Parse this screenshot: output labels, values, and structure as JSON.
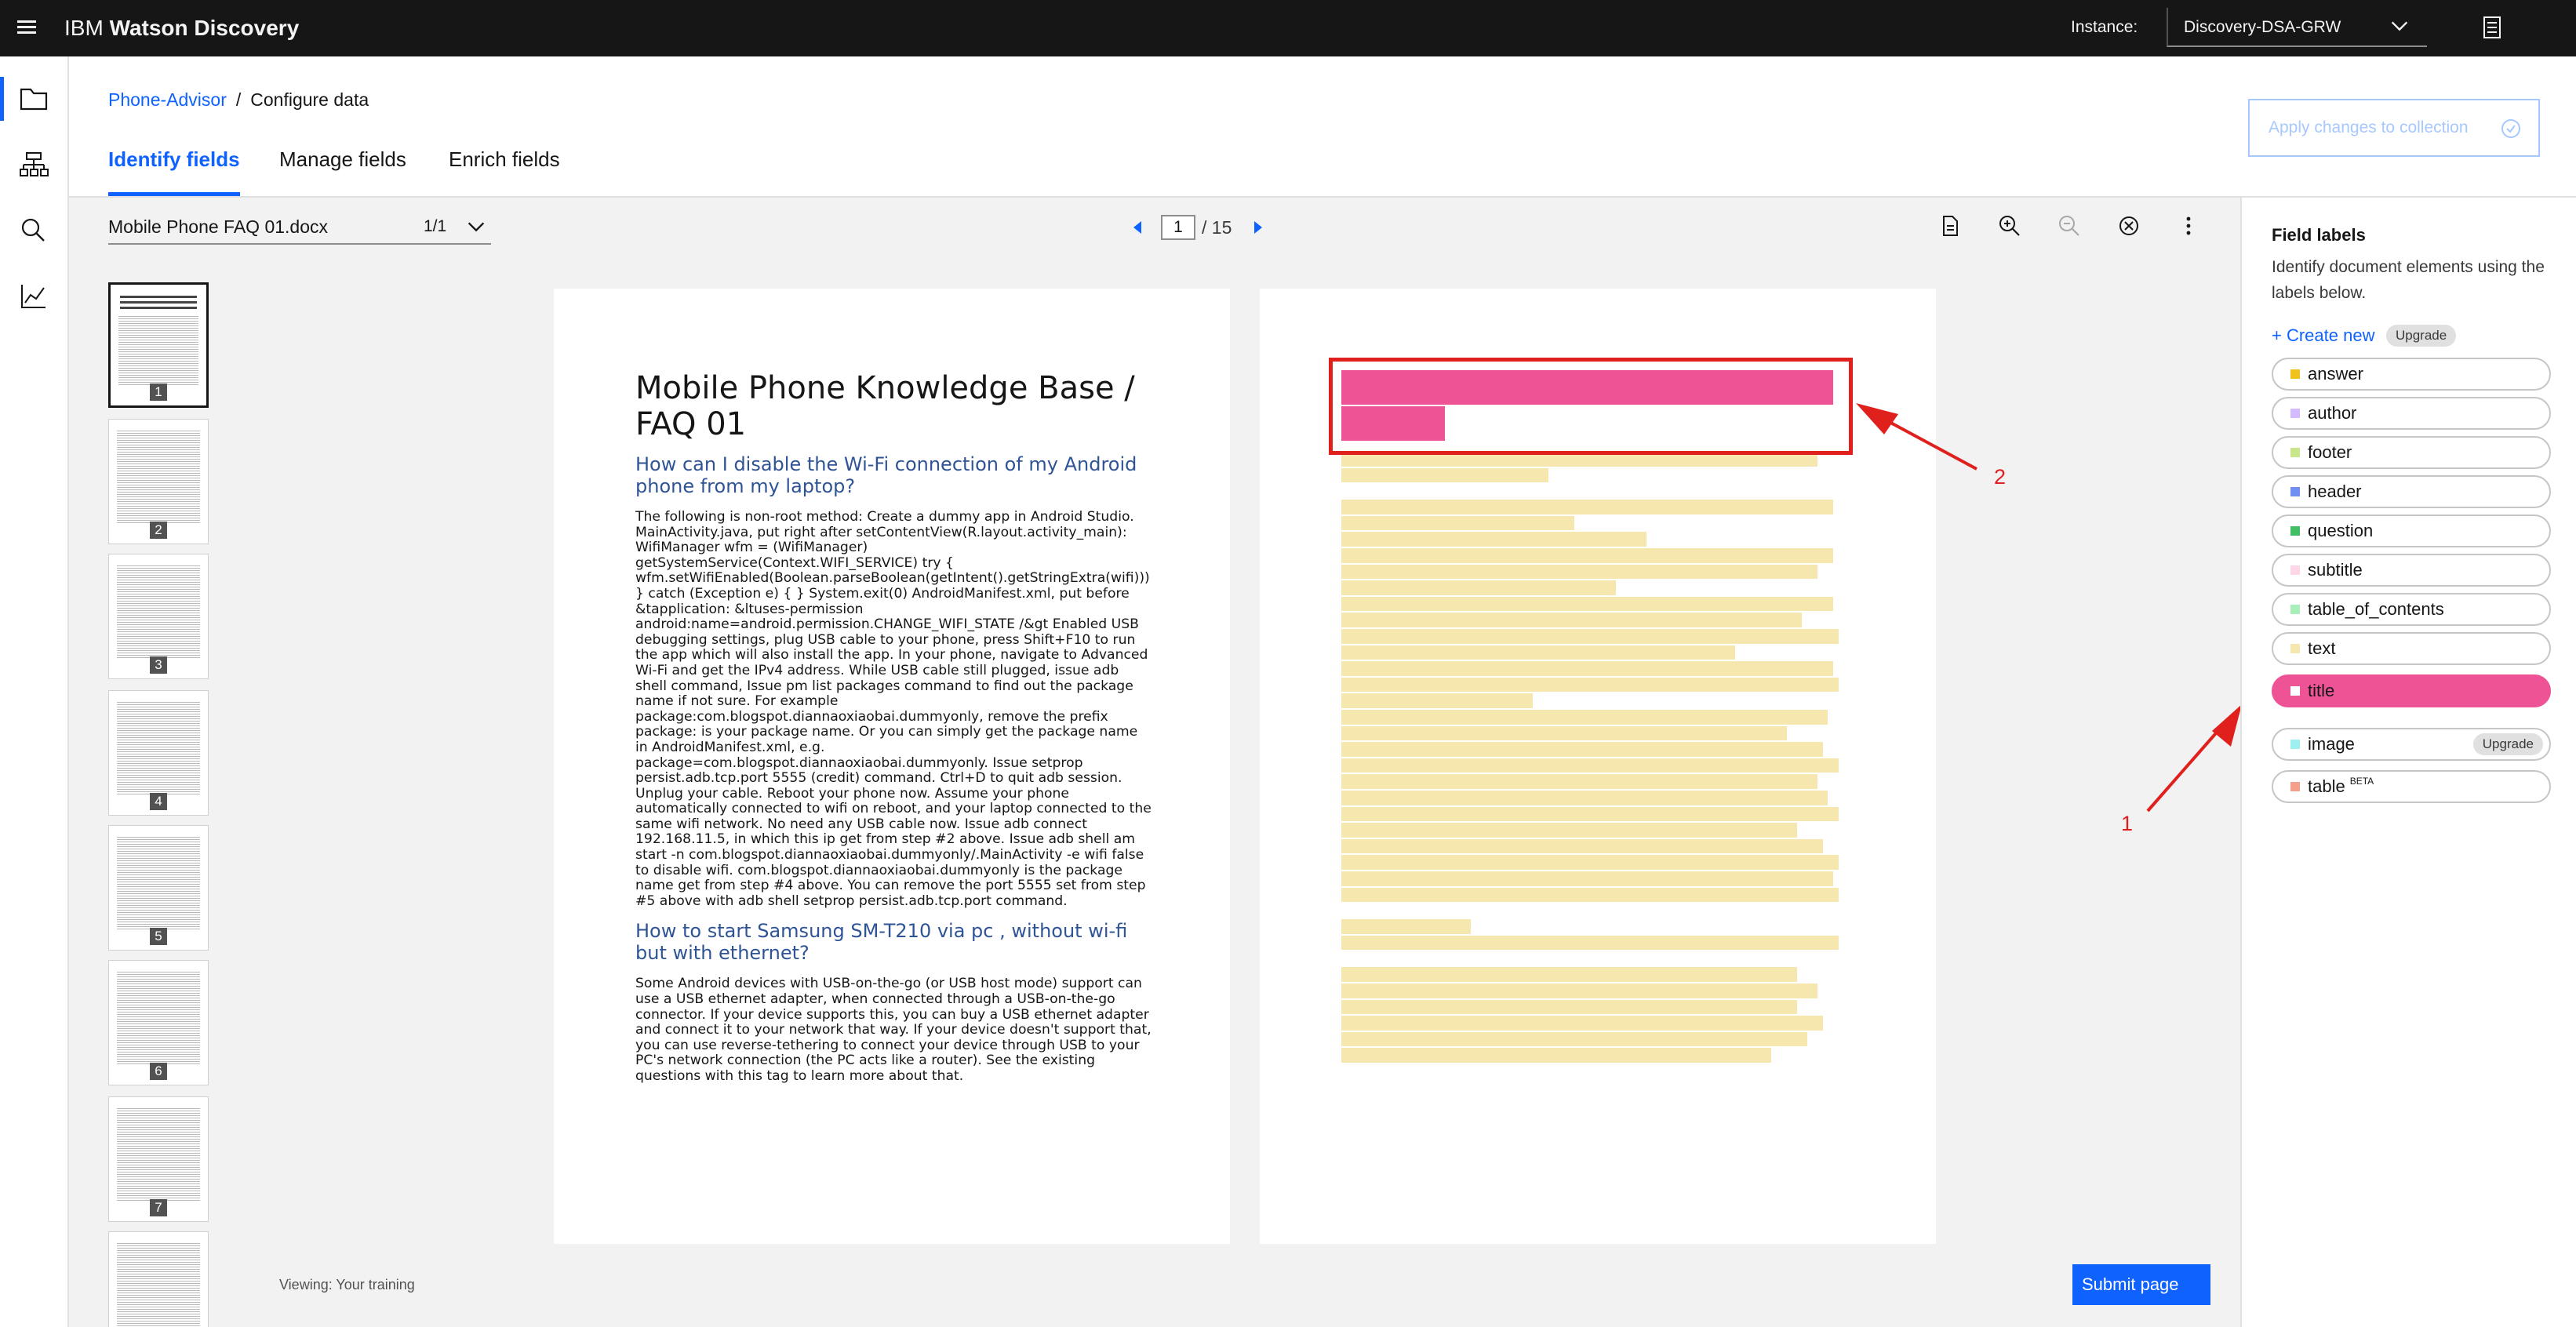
{
  "topbar": {
    "brand_prefix": "IBM",
    "brand_name": "Watson Discovery",
    "instance_label": "Instance:",
    "instance_value": "Discovery-DSA-GRW"
  },
  "breadcrumb": {
    "project": "Phone-Advisor",
    "separator": "/",
    "current": "Configure data"
  },
  "apply_button": "Apply changes to collection",
  "tabs": [
    {
      "label": "Identify fields",
      "active": true
    },
    {
      "label": "Manage fields",
      "active": false
    },
    {
      "label": "Enrich fields",
      "active": false
    }
  ],
  "file": {
    "name": "Mobile Phone FAQ 01.docx",
    "count": "1/1"
  },
  "pager": {
    "current": "1",
    "total": "/ 15"
  },
  "thumbnails": [
    "1",
    "2",
    "3",
    "4",
    "5",
    "6",
    "7"
  ],
  "document": {
    "title": "Mobile Phone Knowledge Base / FAQ 01",
    "q1": "How can I disable the Wi-Fi connection of my Android phone from my laptop?",
    "a1": "The following is non-root method: Create a dummy app in Android Studio. MainActivity.java, put right after setContentView(R.layout.activity_main): WifiManager wfm = (WifiManager) getSystemService(Context.WIFI_SERVICE) try { wfm.setWifiEnabled(Boolean.parseBoolean(getIntent().getStringExtra(wifi))) } catch (Exception e) { } System.exit(0) AndroidManifest.xml, put before &tapplication: &ltuses-permission android:name=android.permission.CHANGE_WIFI_STATE /&gt Enabled USB debugging settings, plug USB cable to your phone, press Shift+F10 to run the app which will also install the app. In your phone, navigate to Advanced Wi-Fi and get the IPv4 address. While USB cable still plugged, issue adb shell command, Issue pm list packages command to find out the package name if not sure. For example package:com.blogspot.diannaoxiaobai.dummyonly, remove the prefix package: is your package name. Or you can simply get the package name in AndroidManifest.xml, e.g. package=com.blogspot.diannaoxiaobai.dummyonly. Issue setprop persist.adb.tcp.port 5555 (credit) command. Ctrl+D to quit adb session. Unplug your cable. Reboot your phone now. Assume your phone automatically connected to wifi on reboot, and your laptop connected to the same wifi network. No need any USB cable now. Issue adb connect 192.168.11.5, in which this ip get from step #2 above. Issue adb shell am start -n com.blogspot.diannaoxiaobai.dummyonly/.MainActivity -e wifi false to disable wifi. com.blogspot.diannaoxiaobai.dummyonly is the package name get from step #4 above. You can remove the port 5555 set from step #5 above with adb shell setprop persist.adb.tcp.port command.",
    "q2": "How to start Samsung SM-T210 via pc , without wi-fi but with ethernet?",
    "a2": "Some Android devices with USB-on-the-go (or USB host mode) support can use a USB ethernet adapter, when connected through a USB-on-the-go connector. If your device supports this, you can buy a USB ethernet adapter and connect it to your network that way. If your device doesn't support that, you can use reverse-tethering to connect your device through USB to your PC's network connection (the PC acts like a router). See the existing questions with this tag to learn more about that."
  },
  "labeled_marks": [
    {
      "label": "title",
      "width_fraction": 0.95
    },
    {
      "label": "title",
      "width_fraction": 0.2
    },
    {
      "label": "text",
      "width_fraction": 0.92
    },
    {
      "label": "text",
      "width_fraction": 0.4
    },
    {
      "label": "text",
      "width_fraction": 0.95
    },
    {
      "label": "text",
      "width_fraction": 0.45
    },
    {
      "label": "text",
      "width_fraction": 0.59
    },
    {
      "label": "text",
      "width_fraction": 0.95
    },
    {
      "label": "text",
      "width_fraction": 0.92
    },
    {
      "label": "text",
      "width_fraction": 0.53
    },
    {
      "label": "text",
      "width_fraction": 0.95
    },
    {
      "label": "text",
      "width_fraction": 0.89
    },
    {
      "label": "text",
      "width_fraction": 0.96
    },
    {
      "label": "text",
      "width_fraction": 0.76
    },
    {
      "label": "text",
      "width_fraction": 0.95
    },
    {
      "label": "text",
      "width_fraction": 0.96
    },
    {
      "label": "text",
      "width_fraction": 0.37
    },
    {
      "label": "text",
      "width_fraction": 0.94
    },
    {
      "label": "text",
      "width_fraction": 0.86
    },
    {
      "label": "text",
      "width_fraction": 0.93
    },
    {
      "label": "text",
      "width_fraction": 0.96
    },
    {
      "label": "text",
      "width_fraction": 0.92
    },
    {
      "label": "text",
      "width_fraction": 0.94
    },
    {
      "label": "text",
      "width_fraction": 0.96
    },
    {
      "label": "text",
      "width_fraction": 0.88
    },
    {
      "label": "text",
      "width_fraction": 0.93
    },
    {
      "label": "text",
      "width_fraction": 0.96
    },
    {
      "label": "text",
      "width_fraction": 0.95
    },
    {
      "label": "text",
      "width_fraction": 0.96
    },
    {
      "label": "text",
      "width_fraction": 0.25
    },
    {
      "label": "text",
      "width_fraction": 0.96
    },
    {
      "label": "text",
      "width_fraction": 0.88
    },
    {
      "label": "text",
      "width_fraction": 0.92
    },
    {
      "label": "text",
      "width_fraction": 0.88
    },
    {
      "label": "text",
      "width_fraction": 0.93
    },
    {
      "label": "text",
      "width_fraction": 0.9
    },
    {
      "label": "text",
      "width_fraction": 0.83
    }
  ],
  "annotations": {
    "arrow_1": "1",
    "arrow_2": "2"
  },
  "footer": {
    "viewing": "Viewing: Your training",
    "submit": "Submit page"
  },
  "field_labels": {
    "title": "Field labels",
    "description": "Identify document elements using the labels below.",
    "create_new": "+ Create new",
    "upgrade": "Upgrade",
    "beta": "BETA",
    "items": [
      {
        "name": "answer",
        "color": "#f1c21b"
      },
      {
        "name": "author",
        "color": "#d4bbff"
      },
      {
        "name": "footer",
        "color": "#c8e68a"
      },
      {
        "name": "header",
        "color": "#6f8ff2"
      },
      {
        "name": "question",
        "color": "#42be65"
      },
      {
        "name": "subtitle",
        "color": "#ffd6e8"
      },
      {
        "name": "table_of_contents",
        "color": "#a7f0ba"
      },
      {
        "name": "text",
        "color": "#f6e7ae"
      },
      {
        "name": "title",
        "color": "#ee5396",
        "selected": true
      }
    ],
    "advanced_items": [
      {
        "name": "image",
        "color": "#9ef0f0",
        "tag": "Upgrade"
      },
      {
        "name": "table",
        "color": "#f4a08a",
        "tag": "BETA"
      }
    ]
  },
  "colors": {
    "accent": "#0f62fe",
    "title_label": "#ee5396",
    "text_label": "#f6e7ae",
    "annotation": "#e0201d"
  }
}
